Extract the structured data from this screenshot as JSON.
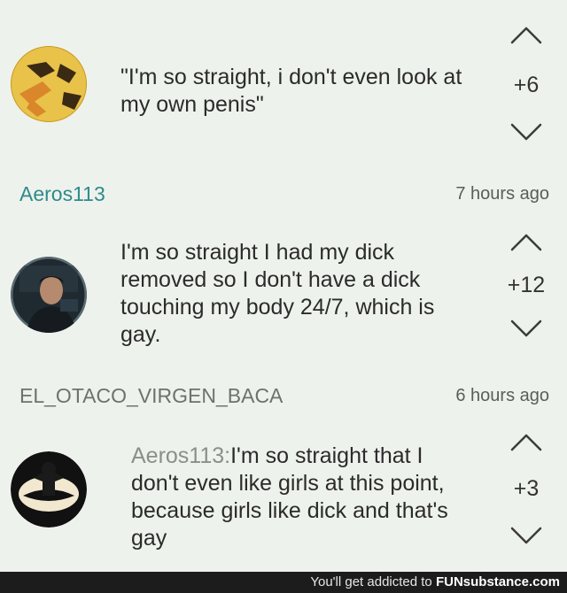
{
  "colors": {
    "background": "#eef2ec",
    "username_teal": "#2f8a8c",
    "username_grey": "#6e716e",
    "footer_bg": "#1c1c1c"
  },
  "comments": [
    {
      "avatar_icon": "yellow-crest-avatar",
      "text": "\"I'm so straight, i don't even look at my own penis\"",
      "score": "+6"
    },
    {
      "username": "Aeros113",
      "time": "7 hours ago",
      "avatar_icon": "man-photo-avatar",
      "text": "I'm so straight I had my dick removed so I don't have a dick touching my body 24/7, which is gay.",
      "score": "+12"
    },
    {
      "username": "EL_OTACO_VIRGEN_BACA",
      "time": "6 hours ago",
      "avatar_icon": "black-emblem-avatar",
      "mention": "Aeros113:",
      "text": "I'm so straight that I don't even like girls at this point, because girls like dick and that's gay",
      "score": "+3"
    }
  ],
  "footer": {
    "prefix": "You'll get addicted to",
    "brand": "FUNsubstance.com"
  }
}
